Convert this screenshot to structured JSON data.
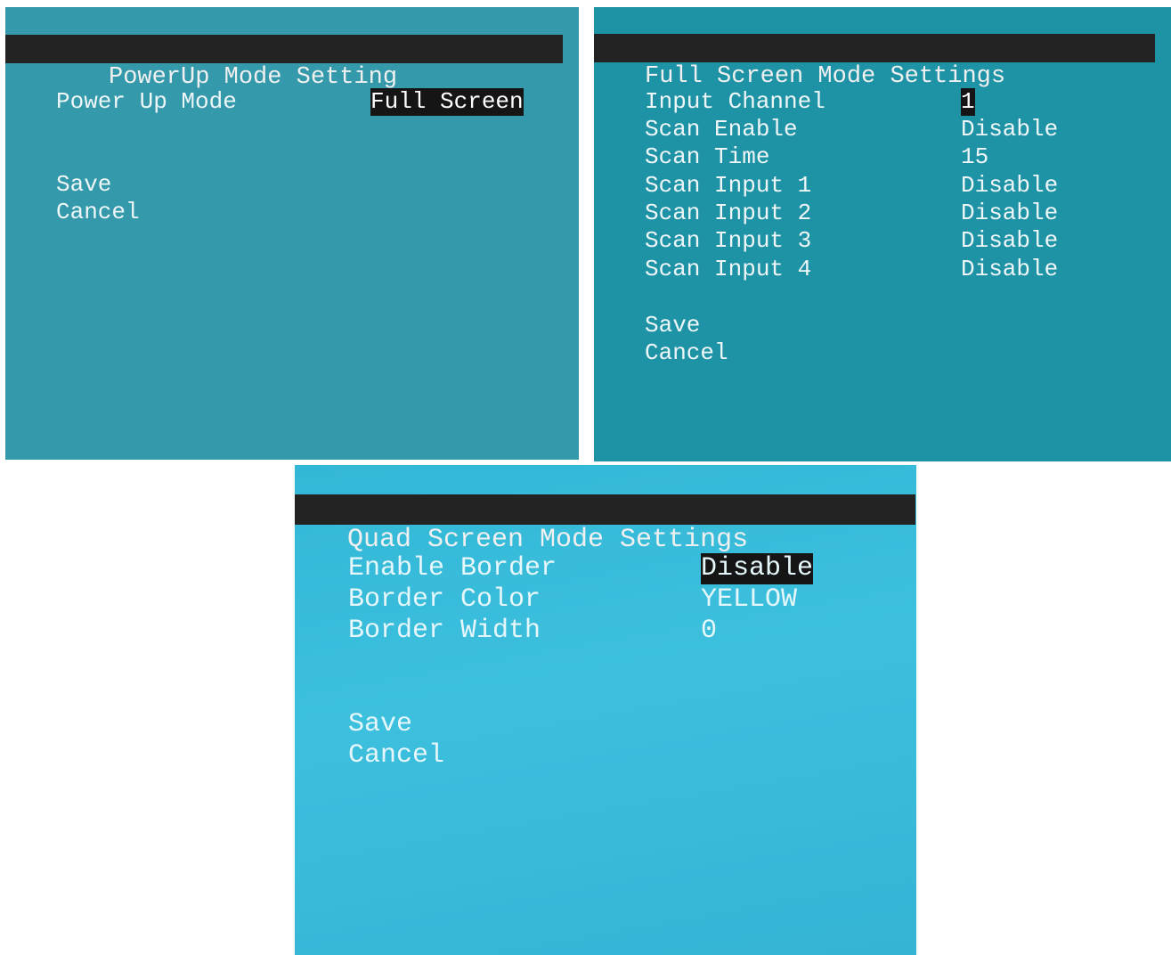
{
  "powerup": {
    "title": "PowerUp Mode Setting",
    "power_up_mode_label": "Power Up Mode",
    "power_up_mode_value": "Full Screen",
    "save": "Save",
    "cancel": "Cancel"
  },
  "full_screen": {
    "title": "Full Screen Mode Settings",
    "rows": [
      {
        "label": "Input Channel",
        "value": "1"
      },
      {
        "label": "Scan Enable",
        "value": "Disable"
      },
      {
        "label": "Scan Time",
        "value": "15"
      },
      {
        "label": "Scan Input 1",
        "value": "Disable"
      },
      {
        "label": "Scan Input 2",
        "value": "Disable"
      },
      {
        "label": "Scan Input 3",
        "value": "Disable"
      },
      {
        "label": "Scan Input 4",
        "value": "Disable"
      }
    ],
    "save": "Save",
    "cancel": "Cancel"
  },
  "quad_screen": {
    "title": "Quad Screen Mode Settings",
    "rows": [
      {
        "label": "Enable Border",
        "value": "Disable"
      },
      {
        "label": "Border Color",
        "value": "YELLOW"
      },
      {
        "label": "Border Width",
        "value": "0"
      }
    ],
    "save": "Save",
    "cancel": "Cancel"
  },
  "colors": {
    "screen1_bg": "#3399ab",
    "screen2_bg": "#1f93a6",
    "screen3_bg": "#3cc0de",
    "title_bar": "#232323",
    "highlight_bg": "#151515",
    "text": "#eef6f8"
  }
}
